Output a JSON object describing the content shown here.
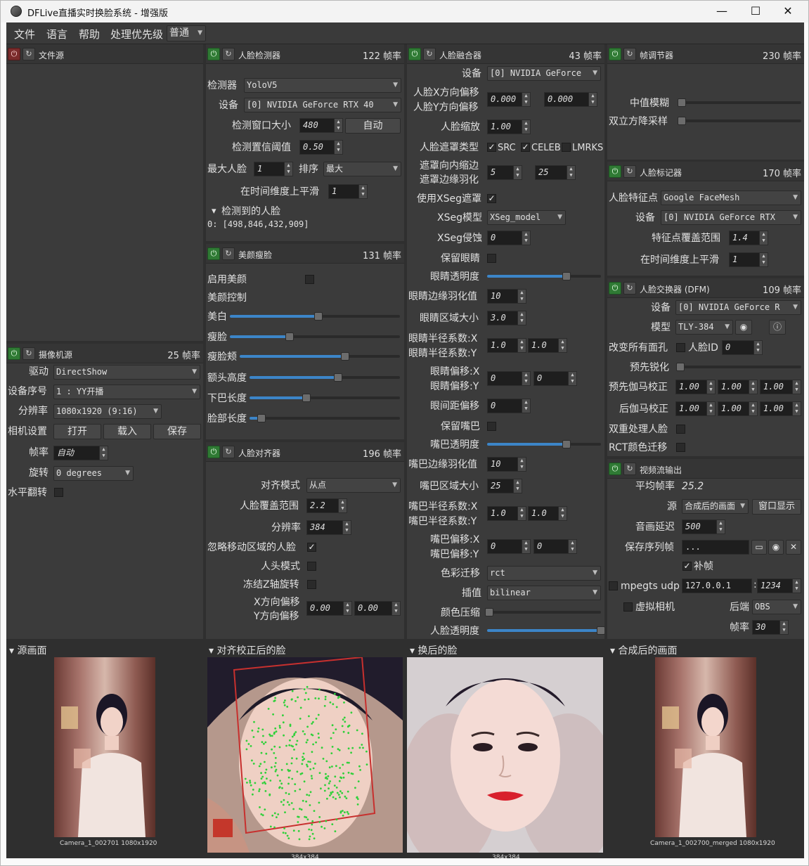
{
  "window": {
    "title": "DFLive直播实时换脸系统 - 增强版",
    "min": "—",
    "max": "☐",
    "close": "✕"
  },
  "menu": {
    "file": "文件",
    "language": "语言",
    "help": "帮助",
    "priority_label": "处理优先级",
    "priority_value": "普通"
  },
  "file_source": {
    "title": "文件源"
  },
  "camera": {
    "title": "摄像机源",
    "fps": "25 帧率",
    "driver_label": "驱动",
    "driver": "DirectShow",
    "index_label": "设备序号",
    "index": "1 : YY开播",
    "res_label": "分辨率",
    "res": "1080x1920 (9:16)",
    "settings_label": "相机设置",
    "open": "打开",
    "load": "载入",
    "save": "保存",
    "fps_label": "帧率",
    "fps_value": "自动",
    "rotate_label": "旋转",
    "rotate": "0 degrees",
    "flip_label": "水平翻转"
  },
  "detector": {
    "title": "人脸检测器",
    "fps": "122 帧率",
    "model_label": "检测器",
    "model": "YoloV5",
    "device_label": "设备",
    "device": "[0] NVIDIA GeForce RTX 40",
    "window_label": "检测窗口大小",
    "window": "480",
    "auto": "自动",
    "threshold_label": "检测置信阈值",
    "threshold": "0.50",
    "max_label": "最大人脸",
    "max": "1",
    "sort_label": "排序",
    "sort": "最大",
    "smooth_label": "在时间维度上平滑",
    "smooth": "1",
    "detected_label": "检测到的人脸",
    "detected": "0: [498,846,432,909]"
  },
  "beauty": {
    "title": "美颜瘦脸",
    "fps": "131 帧率",
    "enable_label": "启用美颜",
    "control_label": "美颜控制",
    "whiten": "美白",
    "whiten_v": 0.52,
    "slim": "瘦脸",
    "slim_v": 0.35,
    "cheek": "瘦脸颊",
    "cheek_v": 0.66,
    "forehead": "额头高度",
    "forehead_v": 0.59,
    "chin": "下巴长度",
    "chin_v": 0.38,
    "face_len": "脸部长度",
    "face_len_v": 0.08
  },
  "aligner": {
    "title": "人脸对齐器",
    "fps": "196 帧率",
    "mode_label": "对齐模式",
    "mode": "从点",
    "coverage_label": "人脸覆盖范围",
    "coverage": "2.2",
    "res_label": "分辨率",
    "res": "384",
    "ignore_label": "忽略移动区域的人脸",
    "head_label": "人头模式",
    "freeze_label": "冻结Z轴旋转",
    "xoff_label": "X方向偏移",
    "yoff_label": "Y方向偏移",
    "xoff": "0.00",
    "yoff": "0.00"
  },
  "merger": {
    "title": "人脸融合器",
    "fps": "43 帧率",
    "device_label": "设备",
    "device": "[0] NVIDIA GeForce",
    "xoff_label": "人脸X方向偏移",
    "yoff_label": "人脸Y方向偏移",
    "xoff": "0.000",
    "yoff": "0.000",
    "scale_label": "人脸缩放",
    "scale": "1.00",
    "mask_label": "人脸遮罩类型",
    "mask_src": "SRC",
    "mask_celeb": "CELEB",
    "mask_lmrks": "LMRKS",
    "erode_label": "遮罩向内缩边",
    "blur_label": "遮罩边缘羽化",
    "erode": "5",
    "blur": "25",
    "xseg_use_label": "使用XSeg遮罩",
    "xseg_model_label": "XSeg模型",
    "xseg_model": "XSeg_model",
    "xseg_erode_label": "XSeg侵蚀",
    "xseg_erode": "0",
    "keep_eyes_label": "保留眼睛",
    "eye_opacity_label": "眼睛透明度",
    "eye_opacity_v": 0.7,
    "eye_feather_label": "眼睛边缘羽化值",
    "eye_feather": "10",
    "eye_size_label": "眼睛区域大小",
    "eye_size": "3.0",
    "eye_rx_label": "眼睛半径系数:X",
    "eye_ry_label": "眼睛半径系数:Y",
    "eye_rx": "1.0",
    "eye_ry": "1.0",
    "eye_ox_label": "眼睛偏移:X",
    "eye_oy_label": "眼睛偏移:Y",
    "eye_ox": "0",
    "eye_oy": "0",
    "eye_dist_label": "眼间距偏移",
    "eye_dist": "0",
    "keep_mouth_label": "保留嘴巴",
    "mouth_opacity_label": "嘴巴透明度",
    "mouth_opacity_v": 0.7,
    "mouth_feather_label": "嘴巴边缘羽化值",
    "mouth_feather": "10",
    "mouth_size_label": "嘴巴区域大小",
    "mouth_size": "25",
    "mouth_rx_label": "嘴巴半径系数:X",
    "mouth_ry_label": "嘴巴半径系数:Y",
    "mouth_rx": "1.0",
    "mouth_ry": "1.0",
    "mouth_ox_label": "嘴巴偏移:X",
    "mouth_oy_label": "嘴巴偏移:Y",
    "mouth_ox": "0",
    "mouth_oy": "0",
    "color_label": "色彩迁移",
    "color": "rct",
    "interp_label": "插值",
    "interp": "bilinear",
    "compress_label": "颜色压缩",
    "compress_v": 0.02,
    "opacity_label": "人脸透明度",
    "opacity_v": 1.0
  },
  "frame_adj": {
    "title": "帧调节器",
    "fps": "230 帧率",
    "median_label": "中值模糊",
    "bilateral_label": "双立方降采样"
  },
  "marker": {
    "title": "人脸标记器",
    "fps": "170 帧率",
    "model_label": "人脸特征点",
    "model": "Google FaceMesh",
    "device_label": "设备",
    "device": "[0] NVIDIA GeForce RTX",
    "range_label": "特征点覆盖范围",
    "range": "1.4",
    "smooth_label": "在时间维度上平滑",
    "smooth": "1"
  },
  "swapper": {
    "title": "人脸交换器 (DFM)",
    "fps": "109 帧率",
    "device_label": "设备",
    "device": "[0] NVIDIA GeForce R",
    "model_label": "模型",
    "model": "TLY-384",
    "change_all_label": "改变所有面孔",
    "face_id_label": "人脸ID",
    "face_id": "0",
    "presharp_label": "预先锐化",
    "pregamma_label": "预先伽马校正",
    "postgamma_label": "后伽马校正",
    "g1": "1.00",
    "g2": "1.00",
    "g3": "1.00",
    "double_label": "双重处理人脸",
    "rct_label": "RCT颜色迁移"
  },
  "stream": {
    "title": "视频流输出",
    "avg_label": "平均帧率",
    "avg": "25.2",
    "source_label": "源",
    "source": "合成后的画面",
    "window_btn": "窗口显示",
    "delay_label": "音画延迟",
    "delay": "500",
    "save_label": "保存序列帧",
    "save_path": "...",
    "fill_label": "补帧",
    "udp_label": "mpegts udp",
    "udp_ip": "127.0.0.1",
    "udp_port": "1234",
    "vcam_label": "虚拟相机",
    "backend_label": "后端",
    "backend": "OBS",
    "fps_label": "帧率",
    "fps": "30"
  },
  "views": {
    "source_label": "源画面",
    "source_cap": "Camera_1_002701 1080x1920",
    "aligned_label": "对齐校正后的脸",
    "aligned_cap": "384x384",
    "swapped_label": "换后的脸",
    "swapped_cap": "384x384",
    "merged_label": "合成后的画面",
    "merged_cap": "Camera_1_002700_merged 1080x1920"
  }
}
